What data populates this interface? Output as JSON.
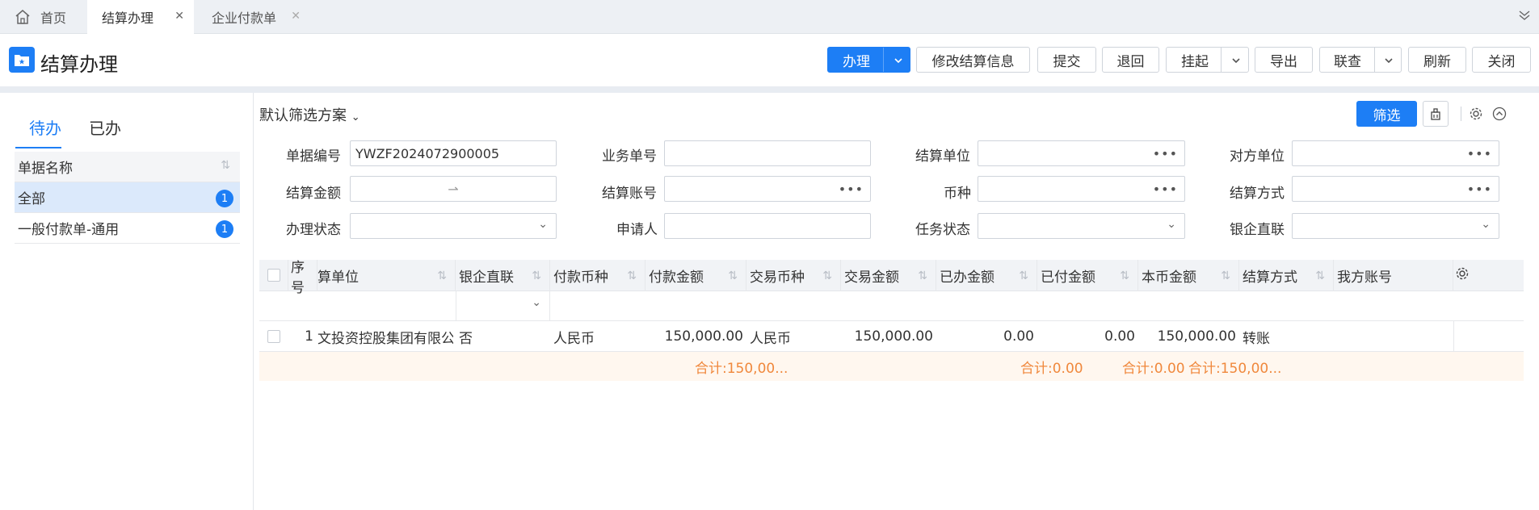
{
  "tabs": [
    {
      "label": "首页",
      "close": ""
    },
    {
      "label": "结算办理",
      "close": "✕"
    },
    {
      "label": "企业付款单",
      "close": "✕"
    }
  ],
  "page_title": "结算办理",
  "toolbar": {
    "handle": "办理",
    "modify": "修改结算信息",
    "submit": "提交",
    "return": "退回",
    "hold": "挂起",
    "export": "导出",
    "link": "联查",
    "refresh": "刷新",
    "close": "关闭"
  },
  "left": {
    "tab_todo": "待办",
    "tab_done": "已办",
    "header": "单据名称",
    "items": [
      {
        "label": "全部",
        "count": "1"
      },
      {
        "label": "一般付款单-通用",
        "count": "1"
      }
    ]
  },
  "scheme": "默认筛选方案",
  "filter_button": "筛选",
  "fields": {
    "doc_no_label": "单据编号",
    "doc_no_value": "YWZF2024072900005",
    "biz_no_label": "业务单号",
    "settle_unit_label": "结算单位",
    "counter_unit_label": "对方单位",
    "amount_label": "结算金额",
    "amount_sep": "⇀",
    "account_label": "结算账号",
    "currency_label": "币种",
    "method_label": "结算方式",
    "status_label": "办理状态",
    "applicant_label": "申请人",
    "task_status_label": "任务状态",
    "bank_label": "银企直联"
  },
  "columns": [
    "序号",
    "算单位",
    "银企直联",
    "付款币种",
    "付款金额",
    "交易币种",
    "交易金额",
    "已办金额",
    "已付金额",
    "本币金额",
    "结算方式",
    "我方账号"
  ],
  "rows": [
    {
      "seq": "1",
      "unit": "文投资控股集团有限公司...",
      "bank": "否",
      "pay_currency": "人民币",
      "pay_amount": "150,000.00",
      "trade_currency": "人民币",
      "trade_amount": "150,000.00",
      "done_amount": "0.00",
      "paid_amount": "0.00",
      "local_amount": "150,000.00",
      "method": "转账",
      "account": ""
    }
  ],
  "totals": {
    "pay_amount": "合计:150,00...",
    "done_amount": "合计:0.00",
    "paid_amount": "合计:0.00",
    "local_amount": "合计:150,00..."
  }
}
